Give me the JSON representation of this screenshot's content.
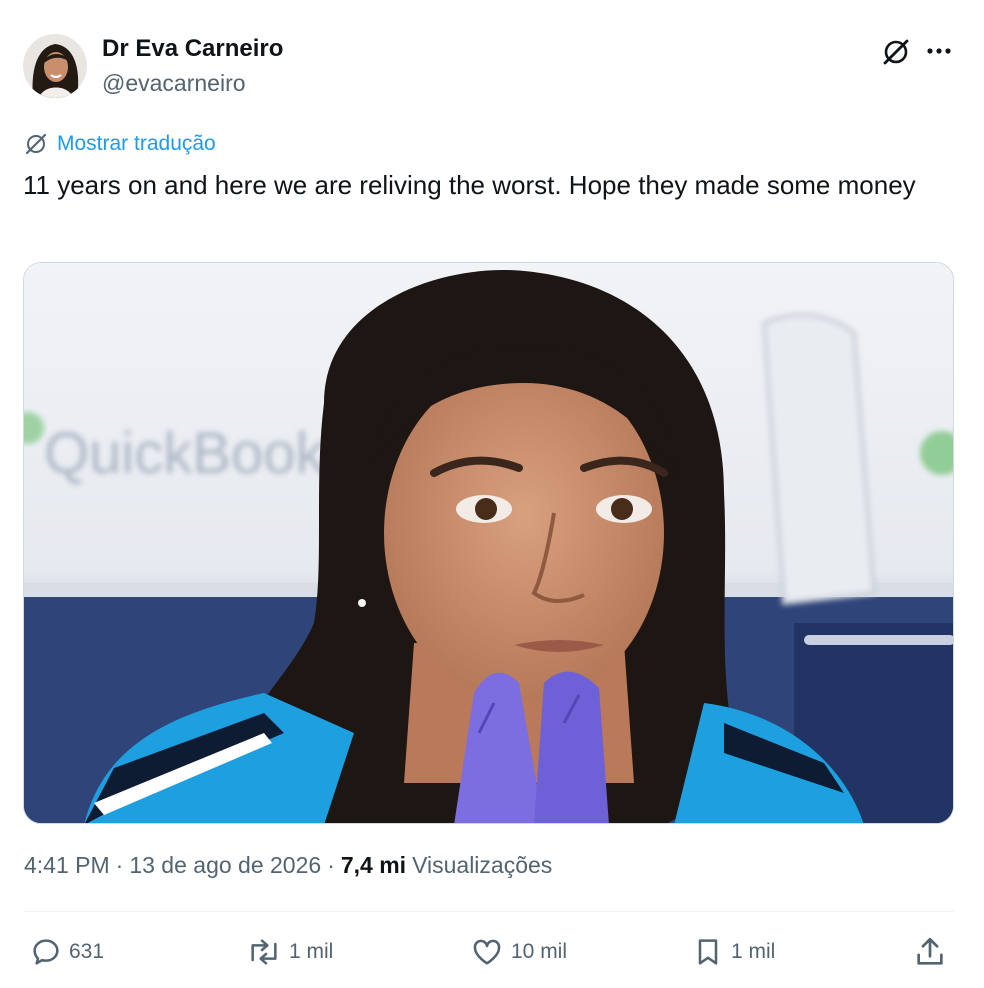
{
  "author": {
    "name": "Dr Eva Carneiro",
    "handle": "@evacarneiro"
  },
  "header_icons": [
    "grok-icon",
    "more-icon"
  ],
  "translate": {
    "label": "Mostrar tradução",
    "icon": "translate-slash-icon"
  },
  "tweet": {
    "text": "11 years on and here we are reliving the worst. Hope they made some money",
    "media_background_text": "QuickBooks"
  },
  "meta": {
    "time": "4:41 PM",
    "separator": "·",
    "date": "13 de ago de 2026",
    "views_count": "7,4 mi",
    "views_label": "Visualizações"
  },
  "actions": {
    "replies": "631",
    "reposts": "1 mil",
    "likes": "10 mil",
    "bookmarks": "1 mil"
  },
  "colors": {
    "link_blue": "#1d9bf0",
    "secondary_text": "#536471",
    "primary_text": "#0f1419",
    "glove_purple": "#7c6ee0",
    "kit_blue": "#1ea0e0"
  }
}
